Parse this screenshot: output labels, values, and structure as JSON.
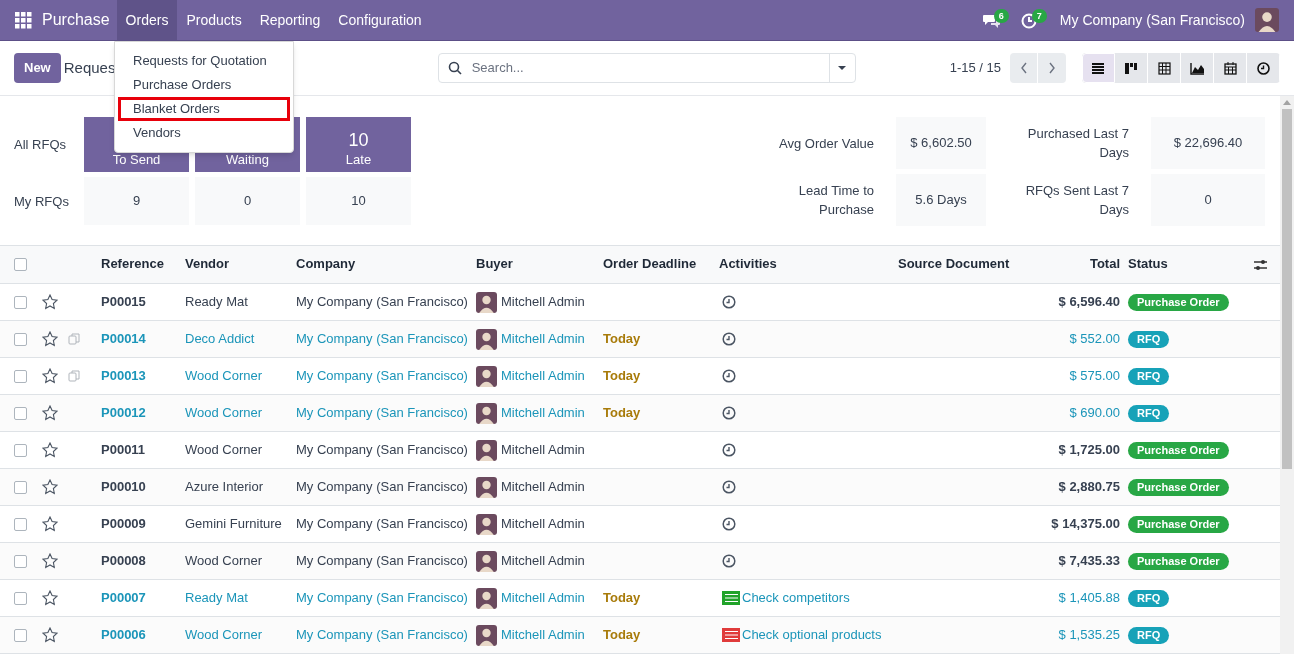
{
  "navbar": {
    "app": "Purchase",
    "menus": [
      {
        "label": "Orders",
        "selected": true
      },
      {
        "label": "Products",
        "selected": false
      },
      {
        "label": "Reporting",
        "selected": false
      },
      {
        "label": "Configuration",
        "selected": false
      }
    ],
    "messages_badge": "6",
    "activities_badge": "7",
    "company": "My Company (San Francisco)"
  },
  "dropdown": {
    "items": [
      {
        "label": "Requests for Quotation",
        "highlighted": false
      },
      {
        "label": "Purchase Orders",
        "highlighted": false
      },
      {
        "label": "Blanket Orders",
        "highlighted": true
      },
      {
        "label": "Vendors",
        "highlighted": false
      }
    ]
  },
  "control_panel": {
    "new_button": "New",
    "title": "Reques",
    "search": {
      "placeholder": "Search..."
    },
    "pager": "1-15 / 15",
    "views": [
      {
        "kind": "list",
        "selected": true
      },
      {
        "kind": "kanban",
        "selected": false
      },
      {
        "kind": "pivot",
        "selected": false
      },
      {
        "kind": "graph",
        "selected": false
      },
      {
        "kind": "calendar",
        "selected": false
      },
      {
        "kind": "activity",
        "selected": false
      }
    ]
  },
  "stats": {
    "rows": [
      {
        "label": "All RFQs",
        "kind": "header",
        "tiles": [
          {
            "caption": "To Send"
          },
          {
            "caption": "Waiting"
          },
          {
            "value": "10",
            "caption": "Late"
          }
        ]
      },
      {
        "label": "My RFQs",
        "kind": "plain",
        "tiles": [
          {
            "value": "9"
          },
          {
            "value": "0"
          },
          {
            "value": "10"
          }
        ]
      }
    ],
    "kpis": [
      {
        "label": "Avg Order Value",
        "value": "$ 6,602.50"
      },
      {
        "label": "Purchased Last 7 Days",
        "value": "$ 22,696.40"
      },
      {
        "label": "Lead Time to Purchase",
        "value": "5.6 Days"
      },
      {
        "label": "RFQs Sent Last 7 Days",
        "value": "0"
      }
    ]
  },
  "table": {
    "all_checked": false,
    "columns": [
      "Reference",
      "Vendor",
      "Company",
      "Buyer",
      "Order Deadline",
      "Activities",
      "Source Document",
      "Total",
      "Status"
    ],
    "rows": [
      {
        "checked": false,
        "starred": false,
        "duplicated": false,
        "reference": "P00015",
        "vendor": "Ready Mat",
        "company": "My Company (San Francisco)",
        "buyer": "Mitchell Admin",
        "deadline": "",
        "activity": {
          "kind": "none"
        },
        "total": "$ 6,596.40",
        "status": {
          "kind": "purchase",
          "label": "Purchase Order"
        }
      },
      {
        "checked": false,
        "starred": false,
        "duplicated": true,
        "reference": "P00014",
        "vendor": "Deco Addict",
        "company": "My Company (San Francisco)",
        "buyer": "Mitchell Admin",
        "deadline": "Today",
        "activity": {
          "kind": "none"
        },
        "total": "$ 552.00",
        "status": {
          "kind": "rfq",
          "label": "RFQ"
        }
      },
      {
        "checked": false,
        "starred": false,
        "duplicated": true,
        "reference": "P00013",
        "vendor": "Wood Corner",
        "company": "My Company (San Francisco)",
        "buyer": "Mitchell Admin",
        "deadline": "Today",
        "activity": {
          "kind": "none"
        },
        "total": "$ 575.00",
        "status": {
          "kind": "rfq",
          "label": "RFQ"
        }
      },
      {
        "checked": false,
        "starred": false,
        "duplicated": false,
        "reference": "P00012",
        "vendor": "Wood Corner",
        "company": "My Company (San Francisco)",
        "buyer": "Mitchell Admin",
        "deadline": "Today",
        "activity": {
          "kind": "none"
        },
        "total": "$ 690.00",
        "status": {
          "kind": "rfq",
          "label": "RFQ"
        }
      },
      {
        "checked": false,
        "starred": false,
        "duplicated": false,
        "reference": "P00011",
        "vendor": "Wood Corner",
        "company": "My Company (San Francisco)",
        "buyer": "Mitchell Admin",
        "deadline": "",
        "activity": {
          "kind": "none"
        },
        "total": "$ 1,725.00",
        "status": {
          "kind": "purchase",
          "label": "Purchase Order"
        }
      },
      {
        "checked": false,
        "starred": false,
        "duplicated": false,
        "reference": "P00010",
        "vendor": "Azure Interior",
        "company": "My Company (San Francisco)",
        "buyer": "Mitchell Admin",
        "deadline": "",
        "activity": {
          "kind": "none"
        },
        "total": "$ 2,880.75",
        "status": {
          "kind": "purchase",
          "label": "Purchase Order"
        }
      },
      {
        "checked": false,
        "starred": false,
        "duplicated": false,
        "reference": "P00009",
        "vendor": "Gemini Furniture",
        "company": "My Company (San Francisco)",
        "buyer": "Mitchell Admin",
        "deadline": "",
        "activity": {
          "kind": "none"
        },
        "total": "$ 14,375.00",
        "status": {
          "kind": "purchase",
          "label": "Purchase Order"
        }
      },
      {
        "checked": false,
        "starred": false,
        "duplicated": false,
        "reference": "P00008",
        "vendor": "Wood Corner",
        "company": "My Company (San Francisco)",
        "buyer": "Mitchell Admin",
        "deadline": "",
        "activity": {
          "kind": "none"
        },
        "total": "$ 7,435.33",
        "status": {
          "kind": "purchase",
          "label": "Purchase Order"
        }
      },
      {
        "checked": false,
        "starred": false,
        "duplicated": false,
        "reference": "P00007",
        "vendor": "Ready Mat",
        "company": "My Company (San Francisco)",
        "buyer": "Mitchell Admin",
        "deadline": "Today",
        "activity": {
          "kind": "todo",
          "label": "Check competitors",
          "color": "#21a32a"
        },
        "total": "$ 1,405.88",
        "status": {
          "kind": "rfq",
          "label": "RFQ"
        }
      },
      {
        "checked": false,
        "starred": false,
        "duplicated": false,
        "reference": "P00006",
        "vendor": "Wood Corner",
        "company": "My Company (San Francisco)",
        "buyer": "Mitchell Admin",
        "deadline": "Today",
        "activity": {
          "kind": "todo",
          "label": "Check optional products",
          "color": "#e03b3b"
        },
        "total": "$ 1,535.25",
        "status": {
          "kind": "rfq",
          "label": "RFQ"
        }
      }
    ]
  }
}
